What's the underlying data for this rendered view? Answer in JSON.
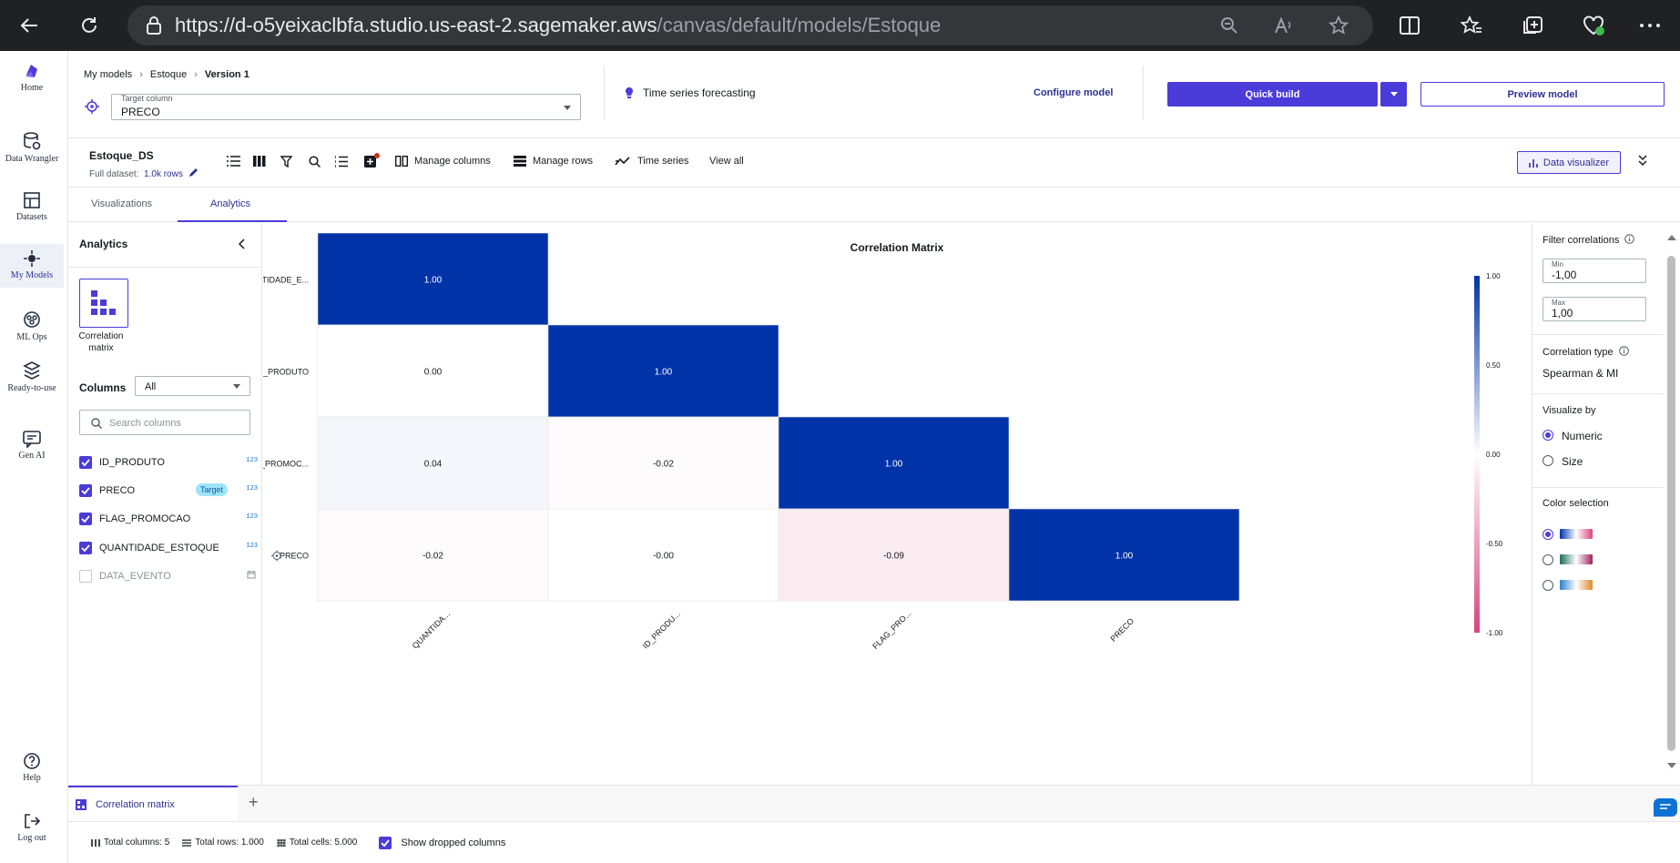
{
  "browser": {
    "url_main": "https://d-o5yeixaclbfa.studio.us-east-2.sagemaker.aws",
    "url_path": "/canvas/default/models/Estoque"
  },
  "nav": {
    "items": [
      {
        "label": "Home",
        "icon": "canvas-logo-icon"
      },
      {
        "label": "Data Wrangler",
        "icon": "database-icon"
      },
      {
        "label": "Datasets",
        "icon": "table-icon"
      },
      {
        "label": "My Models",
        "icon": "models-icon"
      },
      {
        "label": "ML Ops",
        "icon": "mlops-icon"
      },
      {
        "label": "Ready-to-use",
        "icon": "stack-icon"
      },
      {
        "label": "Gen AI",
        "icon": "chat-ai-icon"
      }
    ],
    "help": "Help",
    "logout": "Log out"
  },
  "header": {
    "breadcrumb": [
      "My models",
      "Estoque",
      "Version 1"
    ],
    "target_label": "Target column",
    "target_value": "PRECO",
    "model_type": "Time series forecasting",
    "configure": "Configure model",
    "quick_build": "Quick build",
    "preview": "Preview model"
  },
  "dataset": {
    "name": "Estoque_DS",
    "full_label": "Full dataset:",
    "rows_link": "1.0k rows",
    "manage_columns": "Manage columns",
    "manage_rows": "Manage rows",
    "time_series": "Time series",
    "view_all": "View all",
    "data_visualizer": "Data visualizer"
  },
  "tabs": [
    "Visualizations",
    "Analytics"
  ],
  "analytics_panel": {
    "title": "Analytics",
    "card_label": "Correlation matrix",
    "columns_label": "Columns",
    "columns_filter": "All",
    "search_placeholder": "Search columns",
    "columns": [
      {
        "name": "ID_PRODUTO",
        "checked": true,
        "type": "numeric"
      },
      {
        "name": "PRECO",
        "checked": true,
        "type": "numeric",
        "badge": "Target"
      },
      {
        "name": "FLAG_PROMOCAO",
        "checked": true,
        "type": "numeric"
      },
      {
        "name": "QUANTIDADE_ESTOQUE",
        "checked": true,
        "type": "numeric"
      },
      {
        "name": "DATA_EVENTO",
        "checked": false,
        "type": "date"
      }
    ]
  },
  "chart_data": {
    "type": "heatmap",
    "title": "Correlation Matrix",
    "rows": [
      "QUANTIDADE_E...",
      "ID_PRODUTO",
      "FLAG_PROMOC...",
      "PRECO"
    ],
    "columns": [
      "QUANTIDA...",
      "ID_PRODU...",
      "FLAG_PRO...",
      "PRECO"
    ],
    "values": [
      [
        1.0,
        null,
        null,
        null
      ],
      [
        0.0,
        1.0,
        null,
        null
      ],
      [
        0.04,
        -0.02,
        1.0,
        null
      ],
      [
        -0.02,
        -0.0,
        -0.09,
        1.0
      ]
    ],
    "labels": [
      [
        "1.00",
        "",
        "",
        ""
      ],
      [
        "0.00",
        "1.00",
        "",
        ""
      ],
      [
        "0.04",
        "-0.02",
        "1.00",
        ""
      ],
      [
        "-0.02",
        "-0.00",
        "-0.09",
        "1.00"
      ]
    ],
    "target_row_icon": "target-icon",
    "colorbar": {
      "ticks": [
        "1.00",
        "0.50",
        "0.00",
        "-0.50",
        "-1.00"
      ],
      "range": [
        -1,
        1
      ],
      "high_color": "#0033a8",
      "mid_color": "#ffffff",
      "low_color": "#d9447f"
    }
  },
  "filters": {
    "title": "Filter correlations",
    "min_label": "Min",
    "min_value": "-1,00",
    "max_label": "Max",
    "max_value": "1,00",
    "corr_type_label": "Correlation type",
    "corr_type_value": "Spearman & MI",
    "visualize_by": "Visualize by",
    "vis_options": [
      "Numeric",
      "Size"
    ],
    "color_selection": "Color selection"
  },
  "bottom": {
    "tab": "Correlation matrix",
    "total_columns": "Total columns: 5",
    "total_rows": "Total rows: 1.000",
    "total_cells": "Total cells: 5.000",
    "show_dropped": "Show dropped columns"
  }
}
